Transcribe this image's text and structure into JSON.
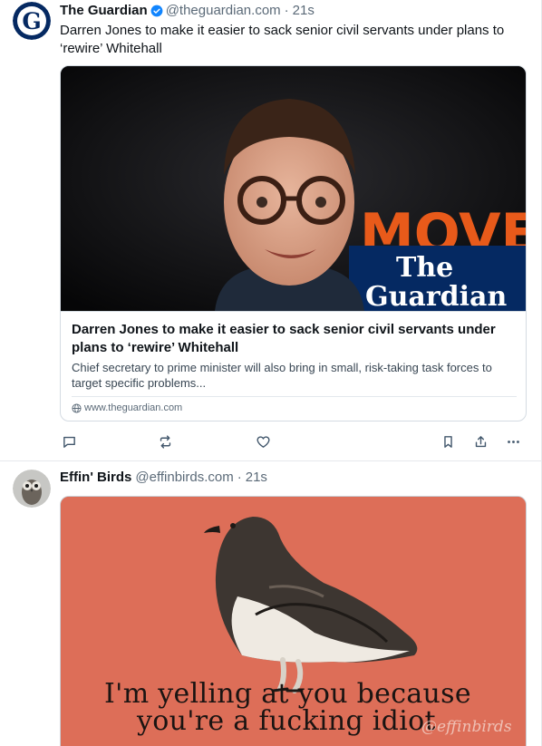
{
  "posts": [
    {
      "author": "The Guardian",
      "handle": "@theguardian.com",
      "time": "21s",
      "text": "Darren Jones to make it easier to sack senior civil servants under plans to ‘rewire’ Whitehall",
      "card": {
        "image_brand_line1": "The",
        "image_brand_line2": "Guardian",
        "image_backdrop_text": "MOVE",
        "title": "Darren Jones to make it easier to sack senior civil servants under plans to ‘rewire’ Whitehall",
        "description": "Chief secretary to prime minister will also bring in small, risk-taking task forces to target specific problems...",
        "domain": "www.theguardian.com"
      },
      "actions": [
        "reply-icon",
        "repost-icon",
        "like-icon",
        "bookmark-icon",
        "share-icon",
        "more-icon"
      ]
    },
    {
      "author": "Effin' Birds",
      "handle": "@effinbirds.com",
      "time": "21s",
      "image": {
        "caption_line1": "I'm yelling at you because",
        "caption_line2": "you're a fucking idiot",
        "signature": "@effinbirds"
      }
    }
  ],
  "colors": {
    "text": "#0f1419",
    "muted": "#5b6a78",
    "verified": "#1185fe",
    "guardian_blue": "#052962",
    "bird_background": "#dd6e58",
    "border": "#e6e9ec"
  },
  "separator": "·"
}
